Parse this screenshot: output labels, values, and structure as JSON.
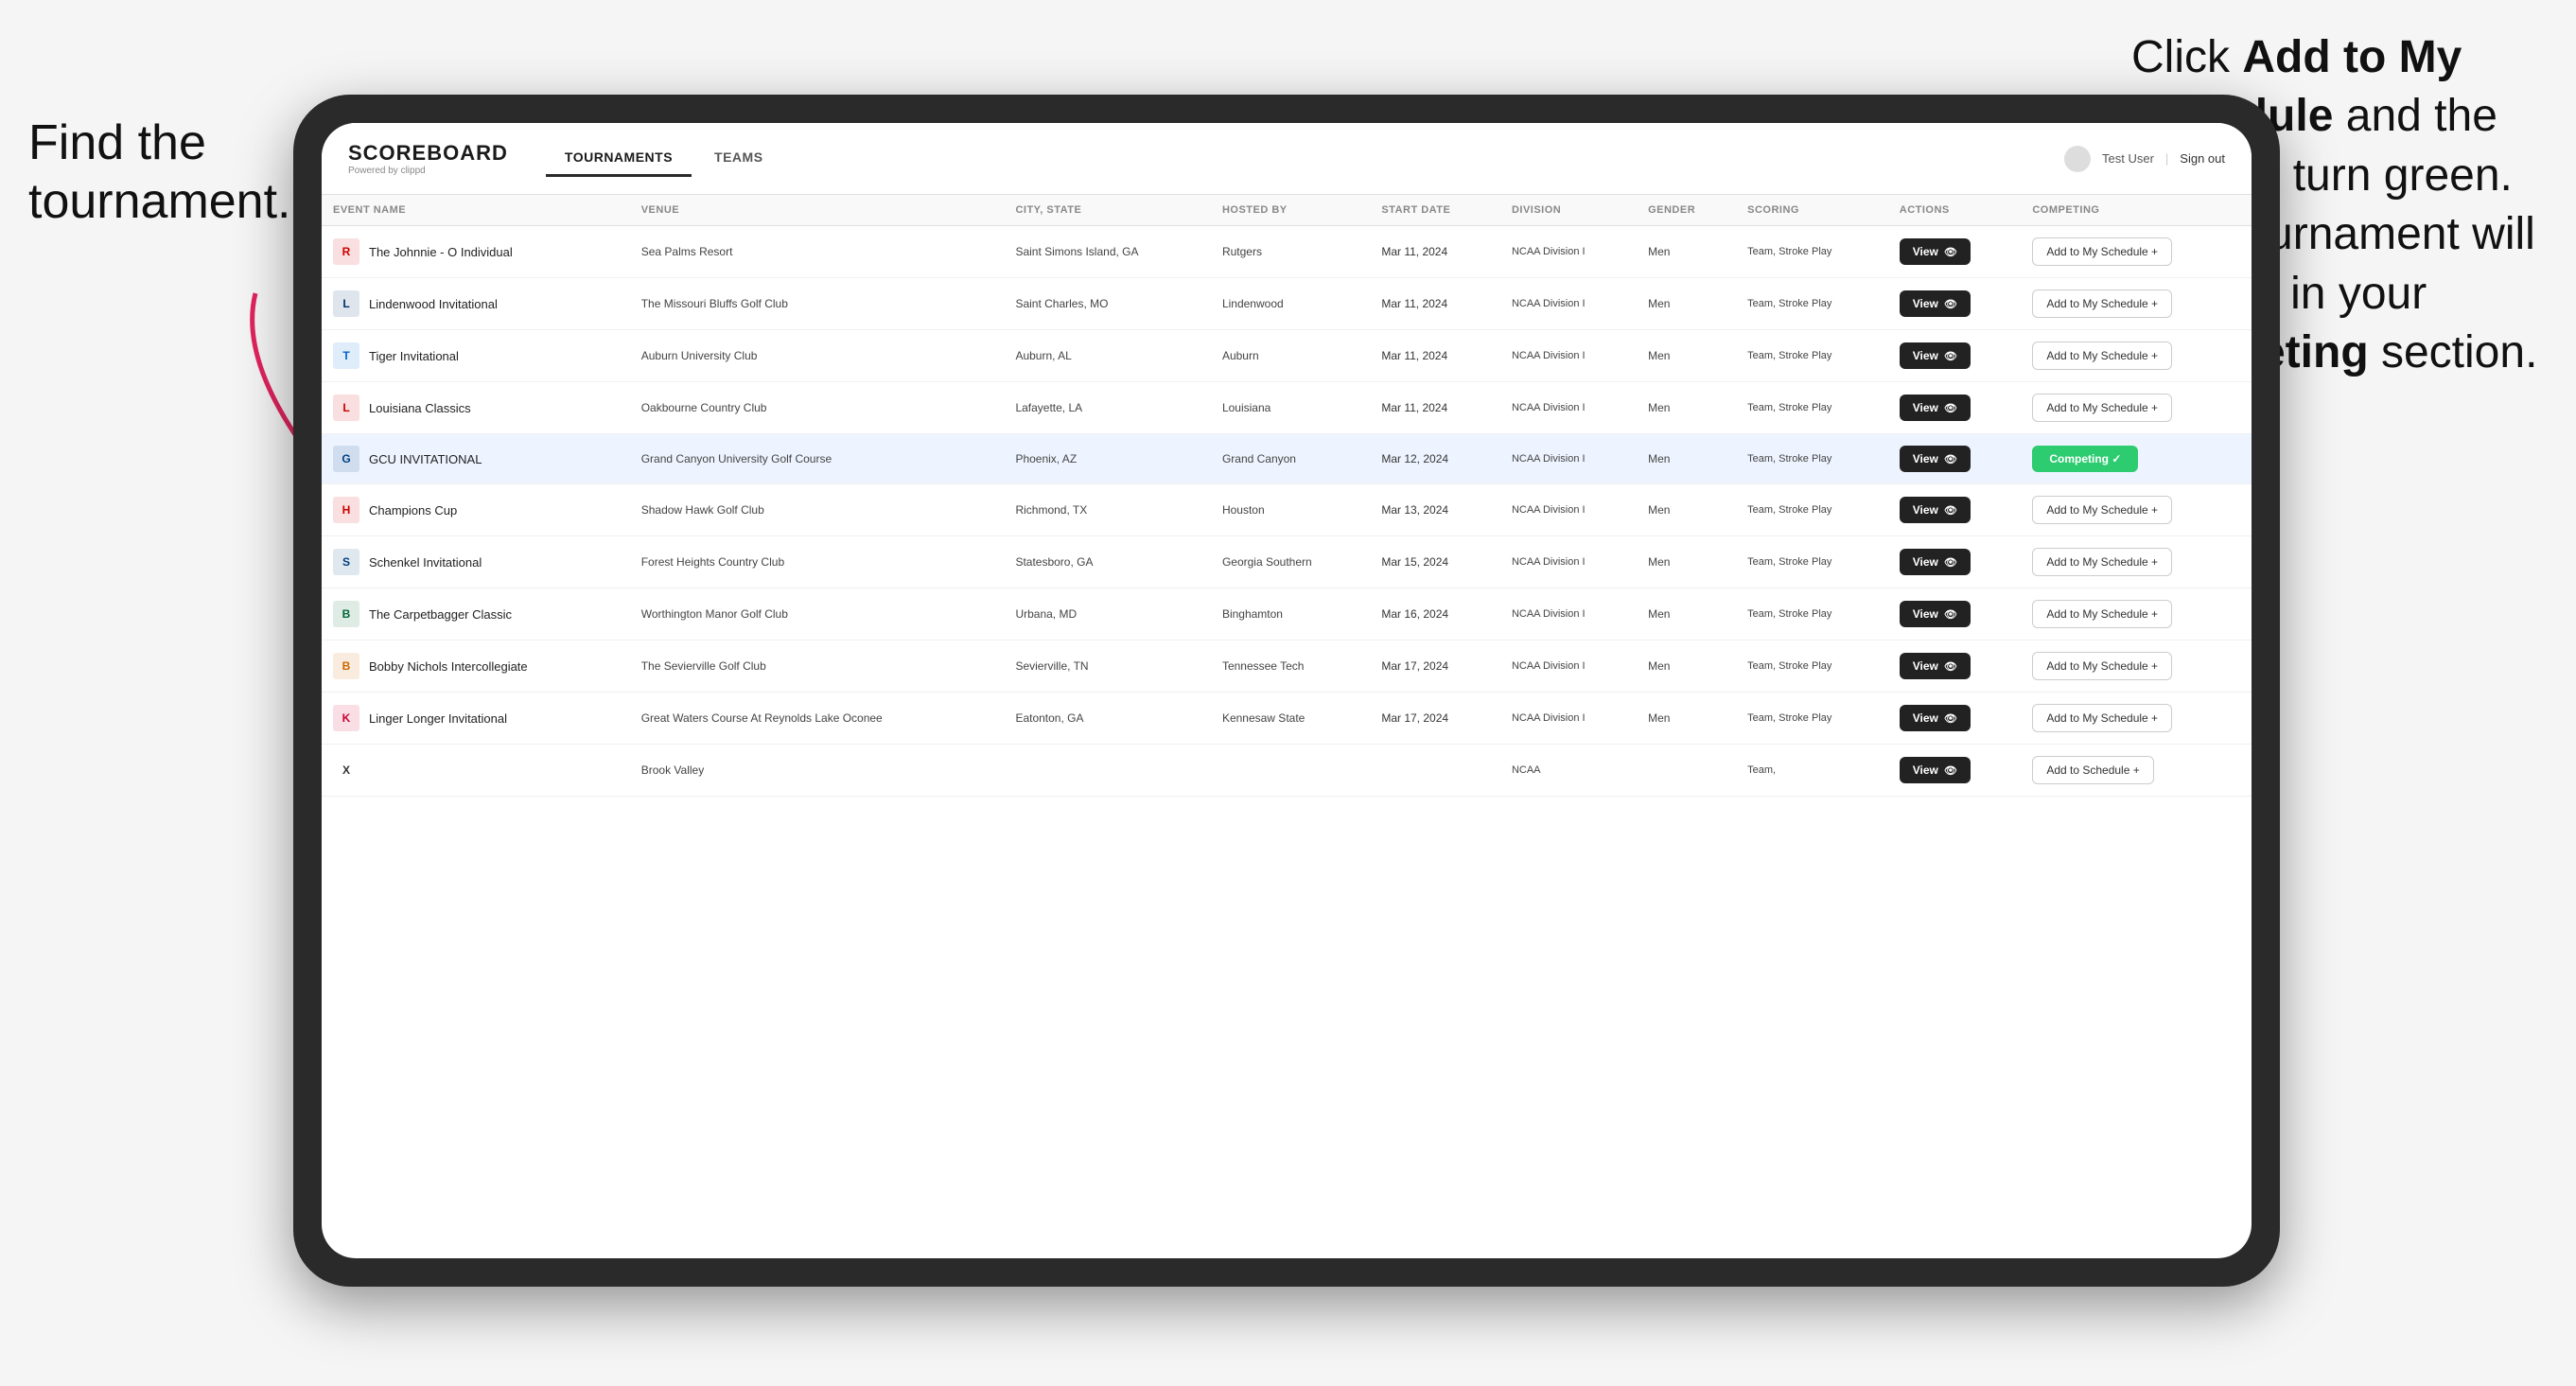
{
  "annotations": {
    "left_title": "Find the tournament.",
    "right_title_normal": "Click ",
    "right_title_bold1": "Add to My Schedule",
    "right_title_and": " and the box will turn green. This tournament will now be in your ",
    "right_title_bold2": "Competing",
    "right_title_end": " section."
  },
  "header": {
    "logo": "SCOREBOARD",
    "logo_sub": "Powered by clippd",
    "nav": [
      "TOURNAMENTS",
      "TEAMS"
    ],
    "active_nav": "TOURNAMENTS",
    "user": "Test User",
    "signout": "Sign out"
  },
  "table": {
    "columns": [
      "EVENT NAME",
      "VENUE",
      "CITY, STATE",
      "HOSTED BY",
      "START DATE",
      "DIVISION",
      "GENDER",
      "SCORING",
      "ACTIONS",
      "COMPETING"
    ],
    "rows": [
      {
        "logo_color": "#cc0000",
        "logo_text": "R",
        "event_name": "The Johnnie - O Individual",
        "venue": "Sea Palms Resort",
        "city_state": "Saint Simons Island, GA",
        "hosted_by": "Rutgers",
        "start_date": "Mar 11, 2024",
        "division": "NCAA Division I",
        "gender": "Men",
        "scoring": "Team, Stroke Play",
        "action": "View",
        "competing": "Add to My Schedule +",
        "is_competing": false,
        "highlighted": false
      },
      {
        "logo_color": "#003366",
        "logo_text": "L",
        "event_name": "Lindenwood Invitational",
        "venue": "The Missouri Bluffs Golf Club",
        "city_state": "Saint Charles, MO",
        "hosted_by": "Lindenwood",
        "start_date": "Mar 11, 2024",
        "division": "NCAA Division I",
        "gender": "Men",
        "scoring": "Team, Stroke Play",
        "action": "View",
        "competing": "Add to My Schedule +",
        "is_competing": false,
        "highlighted": false
      },
      {
        "logo_color": "#0066cc",
        "logo_text": "T",
        "event_name": "Tiger Invitational",
        "venue": "Auburn University Club",
        "city_state": "Auburn, AL",
        "hosted_by": "Auburn",
        "start_date": "Mar 11, 2024",
        "division": "NCAA Division I",
        "gender": "Men",
        "scoring": "Team, Stroke Play",
        "action": "View",
        "competing": "Add to My Schedule +",
        "is_competing": false,
        "highlighted": false
      },
      {
        "logo_color": "#cc0000",
        "logo_text": "L",
        "event_name": "Louisiana Classics",
        "venue": "Oakbourne Country Club",
        "city_state": "Lafayette, LA",
        "hosted_by": "Louisiana",
        "start_date": "Mar 11, 2024",
        "division": "NCAA Division I",
        "gender": "Men",
        "scoring": "Team, Stroke Play",
        "action": "View",
        "competing": "Add to My Schedule +",
        "is_competing": false,
        "highlighted": false
      },
      {
        "logo_color": "#004080",
        "logo_text": "G",
        "event_name": "GCU INVITATIONAL",
        "venue": "Grand Canyon University Golf Course",
        "city_state": "Phoenix, AZ",
        "hosted_by": "Grand Canyon",
        "start_date": "Mar 12, 2024",
        "division": "NCAA Division I",
        "gender": "Men",
        "scoring": "Team, Stroke Play",
        "action": "View",
        "competing": "Competing ✓",
        "is_competing": true,
        "highlighted": true
      },
      {
        "logo_color": "#cc0000",
        "logo_text": "H",
        "event_name": "Champions Cup",
        "venue": "Shadow Hawk Golf Club",
        "city_state": "Richmond, TX",
        "hosted_by": "Houston",
        "start_date": "Mar 13, 2024",
        "division": "NCAA Division I",
        "gender": "Men",
        "scoring": "Team, Stroke Play",
        "action": "View",
        "competing": "Add to My Schedule +",
        "is_competing": false,
        "highlighted": false
      },
      {
        "logo_color": "#004080",
        "logo_text": "S",
        "event_name": "Schenkel Invitational",
        "venue": "Forest Heights Country Club",
        "city_state": "Statesboro, GA",
        "hosted_by": "Georgia Southern",
        "start_date": "Mar 15, 2024",
        "division": "NCAA Division I",
        "gender": "Men",
        "scoring": "Team, Stroke Play",
        "action": "View",
        "competing": "Add to My Schedule +",
        "is_competing": false,
        "highlighted": false
      },
      {
        "logo_color": "#006633",
        "logo_text": "B",
        "event_name": "The Carpetbagger Classic",
        "venue": "Worthington Manor Golf Club",
        "city_state": "Urbana, MD",
        "hosted_by": "Binghamton",
        "start_date": "Mar 16, 2024",
        "division": "NCAA Division I",
        "gender": "Men",
        "scoring": "Team, Stroke Play",
        "action": "View",
        "competing": "Add to My Schedule +",
        "is_competing": false,
        "highlighted": false
      },
      {
        "logo_color": "#cc6600",
        "logo_text": "B",
        "event_name": "Bobby Nichols Intercollegiate",
        "venue": "The Sevierville Golf Club",
        "city_state": "Sevierville, TN",
        "hosted_by": "Tennessee Tech",
        "start_date": "Mar 17, 2024",
        "division": "NCAA Division I",
        "gender": "Men",
        "scoring": "Team, Stroke Play",
        "action": "View",
        "competing": "Add to My Schedule +",
        "is_competing": false,
        "highlighted": false
      },
      {
        "logo_color": "#cc0033",
        "logo_text": "K",
        "event_name": "Linger Longer Invitational",
        "venue": "Great Waters Course At Reynolds Lake Oconee",
        "city_state": "Eatonton, GA",
        "hosted_by": "Kennesaw State",
        "start_date": "Mar 17, 2024",
        "division": "NCAA Division I",
        "gender": "Men",
        "scoring": "Team, Stroke Play",
        "action": "View",
        "competing": "Add to My Schedule +",
        "is_competing": false,
        "highlighted": false
      },
      {
        "logo_color": "#333",
        "logo_text": "X",
        "event_name": "",
        "venue": "Brook Valley",
        "city_state": "",
        "hosted_by": "",
        "start_date": "",
        "division": "NCAA",
        "gender": "",
        "scoring": "Team,",
        "action": "View",
        "competing": "Add to Schedule +",
        "is_competing": false,
        "highlighted": false,
        "partial": true
      }
    ]
  }
}
